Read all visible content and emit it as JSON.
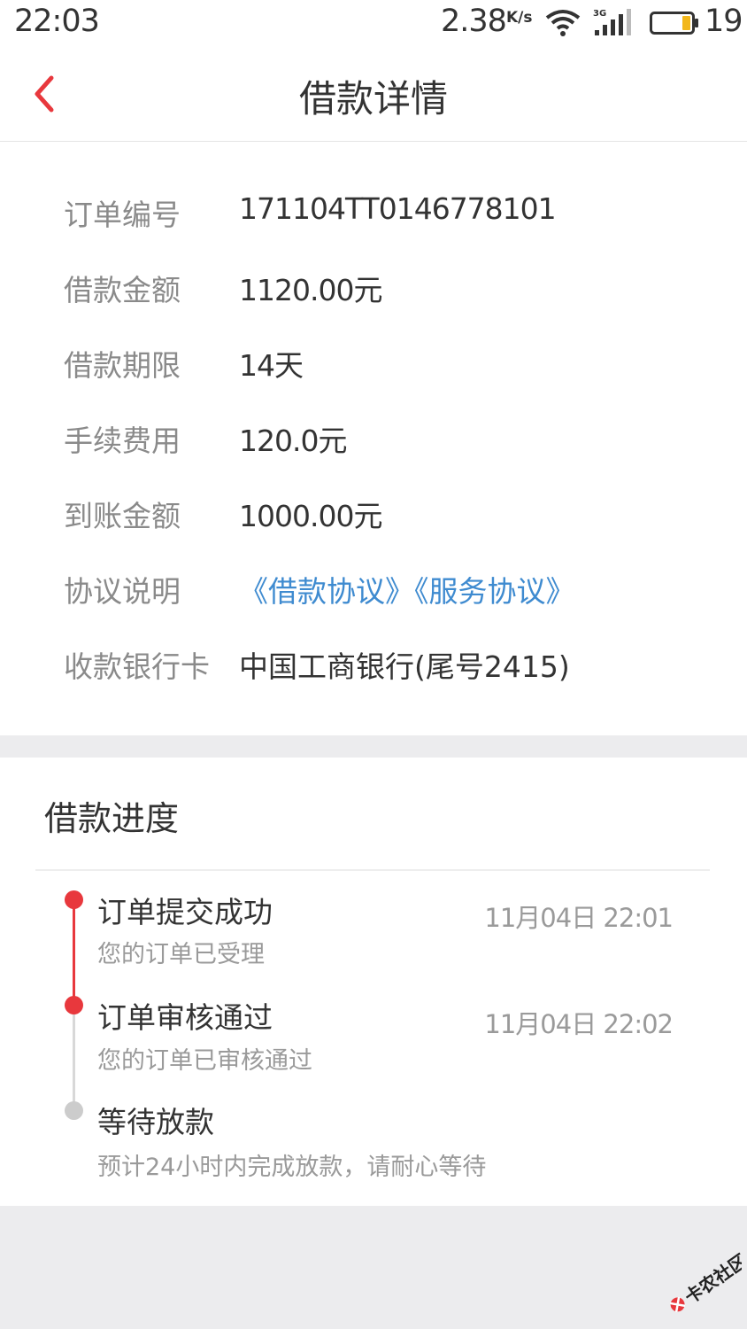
{
  "status_bar": {
    "time": "22:03",
    "net_speed": "2.38",
    "net_speed_unit": "K/s",
    "network_type": "3G",
    "battery_level": "19"
  },
  "nav": {
    "title": "借款详情",
    "back_icon": "chevron-left-icon"
  },
  "details": [
    {
      "label": "订单编号",
      "value": "171104TT0146778101"
    },
    {
      "label": "借款金额",
      "value": "1120.00元"
    },
    {
      "label": "借款期限",
      "value": "14天"
    },
    {
      "label": "手续费用",
      "value": "120.0元"
    },
    {
      "label": "到账金额",
      "value": "1000.00元"
    },
    {
      "label": "协议说明",
      "links": [
        "《借款协议》",
        "《服务协议》"
      ]
    },
    {
      "label": "收款银行卡",
      "value": "中国工商银行(尾号2415)"
    }
  ],
  "progress": {
    "title": "借款进度",
    "steps": [
      {
        "title": "订单提交成功",
        "desc": "您的订单已受理",
        "time": "11月04日  22:01",
        "status": "done"
      },
      {
        "title": "订单审核通过",
        "desc": "您的订单已审核通过",
        "time": "11月04日  22:02",
        "status": "done"
      },
      {
        "title": "等待放款",
        "desc": "预计24小时内完成放款，请耐心等待",
        "time": "",
        "status": "pending"
      }
    ]
  },
  "watermark": {
    "text": "卡农社区"
  },
  "colors": {
    "accent": "#e8383d",
    "link": "#3f8bd0",
    "label": "#8a8a8a",
    "text": "#333333",
    "pending": "#cccccc",
    "page_bg": "#ececee"
  }
}
